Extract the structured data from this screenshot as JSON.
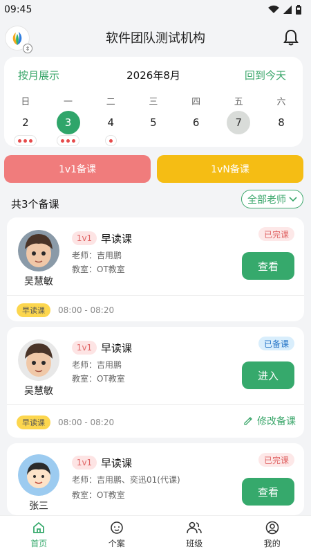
{
  "status": {
    "time": "09:45"
  },
  "header": {
    "title": "软件团队测试机构",
    "logo_icon": "org-logo-icon",
    "switch_icon": "switch-icon",
    "bell_icon": "bell-icon"
  },
  "calendar": {
    "by_month_label": "按月展示",
    "month_label": "2026年8月",
    "today_label": "回到今天",
    "days": [
      {
        "weekday": "日",
        "date": "2",
        "dots": 3,
        "state": ""
      },
      {
        "weekday": "一",
        "date": "3",
        "dots": 3,
        "state": "selected"
      },
      {
        "weekday": "二",
        "date": "4",
        "dots": 1,
        "state": ""
      },
      {
        "weekday": "三",
        "date": "5",
        "dots": 0,
        "state": ""
      },
      {
        "weekday": "四",
        "date": "6",
        "dots": 0,
        "state": ""
      },
      {
        "weekday": "五",
        "date": "7",
        "dots": 0,
        "state": "today"
      },
      {
        "weekday": "六",
        "date": "8",
        "dots": 0,
        "state": ""
      }
    ]
  },
  "tabs": {
    "one_on_one": "1v1备课",
    "one_on_n": "1vN备课"
  },
  "summary": {
    "count_label": "共3个备课",
    "teacher_filter": "全部老师"
  },
  "lessons": [
    {
      "type": "1v1",
      "course": "早读课",
      "teacher": "老师：吉用鹏",
      "room": "教室：OT教室",
      "student": "吴慧敏",
      "state_label": "已完课",
      "action": "查看",
      "tag": "早读课",
      "time": "08:00 - 08:20",
      "edit": ""
    },
    {
      "type": "1v1",
      "course": "早读课",
      "teacher": "老师：吉用鹏",
      "room": "教室：OT教室",
      "student": "吴慧敏",
      "state_label": "已备课",
      "action": "进入",
      "tag": "早读课",
      "time": "08:00 - 08:20",
      "edit": "修改备课"
    },
    {
      "type": "1v1",
      "course": "早读课",
      "teacher": "老师：吉用鹏、奕迅01(代课)",
      "room": "教室：OT教室",
      "student": "张三",
      "state_label": "已完课",
      "action": "查看",
      "tag": "",
      "time": "",
      "edit": ""
    }
  ],
  "nav": [
    {
      "label": "首页",
      "icon": "home-icon",
      "active": true
    },
    {
      "label": "个案",
      "icon": "case-icon",
      "active": false
    },
    {
      "label": "班级",
      "icon": "class-icon",
      "active": false
    },
    {
      "label": "我的",
      "icon": "profile-icon",
      "active": false
    }
  ],
  "colors": {
    "primary": "#36a96c",
    "danger": "#f07c7c",
    "warning": "#f5bd14"
  }
}
